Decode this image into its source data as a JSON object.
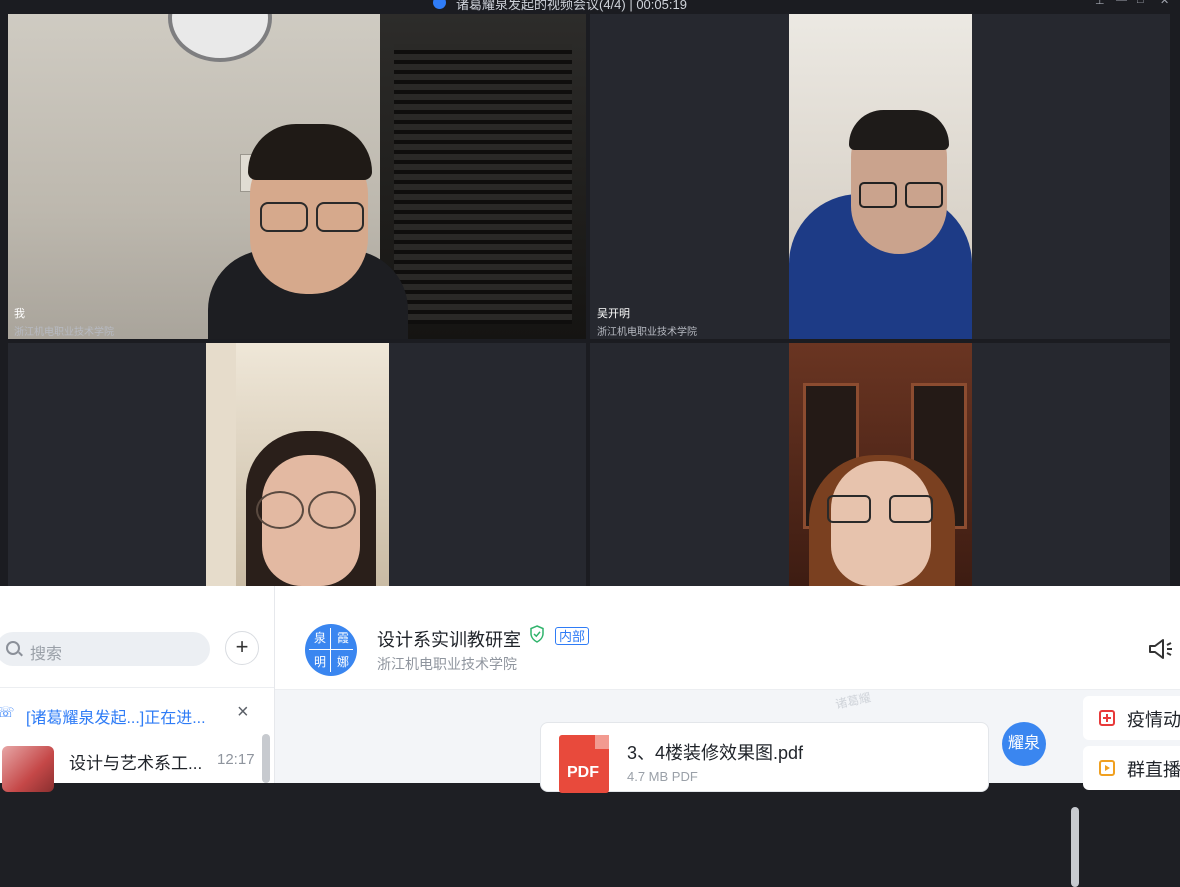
{
  "window": {
    "title": "诸葛耀泉发起的视频会议(4/4) | 00:05:19",
    "controls": [
      "pin-icon",
      "minimize-icon",
      "maximize-icon",
      "close-icon"
    ]
  },
  "participants": [
    {
      "name": "我",
      "org": "浙江机电职业技术学院"
    },
    {
      "name": "吴开明",
      "org": "浙江机电职业技术学院"
    },
    {
      "name": "",
      "org": ""
    },
    {
      "name": "",
      "org": ""
    }
  ],
  "sidebar": {
    "search_placeholder": "搜索",
    "add_label": "+",
    "notice": {
      "text": "[诸葛耀泉发起...]正在进...",
      "close": "×"
    },
    "conversations": [
      {
        "name": "设计与艺术系工...",
        "time": "12:17"
      }
    ]
  },
  "chat": {
    "group_name": "设计系实训教研室",
    "group_tag": "内部",
    "group_org": "浙江机电职业技术学院",
    "group_avatar_chars": [
      "泉",
      "霞",
      "明",
      "娜"
    ],
    "watermark": "诸葛耀",
    "message": {
      "file_type": "PDF",
      "file_name": "3、4楼装修效果图.pdf",
      "file_meta": "4.7 MB  PDF",
      "sender_avatar": "耀泉"
    }
  },
  "right_panel": {
    "items": [
      {
        "label": "疫情动",
        "icon": "epidemic-icon",
        "color": "#e83a3a"
      },
      {
        "label": "群直播",
        "icon": "live-icon",
        "color": "#f0a020"
      }
    ]
  },
  "colors": {
    "accent": "#2f7cf6",
    "pdf": "#e84a3c",
    "verified": "#2fb36b"
  }
}
